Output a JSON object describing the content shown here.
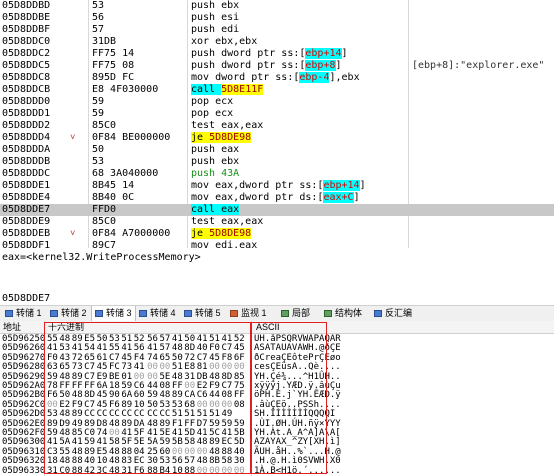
{
  "disasm": [
    {
      "addr": "05D8DDBD",
      "arrow": "",
      "bytes": "53",
      "instr": [
        [
          "push ebx",
          ""
        ]
      ],
      "cmt": ""
    },
    {
      "addr": "05D8DDBE",
      "arrow": "",
      "bytes": "56",
      "instr": [
        [
          "push esi",
          ""
        ]
      ],
      "cmt": ""
    },
    {
      "addr": "05D8DDBF",
      "arrow": "",
      "bytes": "57",
      "instr": [
        [
          "push edi",
          ""
        ]
      ],
      "cmt": ""
    },
    {
      "addr": "05D8DDC0",
      "arrow": "",
      "bytes": "31DB",
      "instr": [
        [
          "xor ebx,ebx",
          ""
        ]
      ],
      "cmt": ""
    },
    {
      "addr": "05D8DDC2",
      "arrow": "",
      "bytes": "FF75 14",
      "instr": [
        [
          "push dword ptr ss:[",
          ""
        ],
        [
          "ebp+14",
          "cyan"
        ],
        [
          "]",
          ""
        ]
      ],
      "cmt": ""
    },
    {
      "addr": "05D8DDC5",
      "arrow": "",
      "bytes": "FF75 08",
      "instr": [
        [
          "push dword ptr ss:[",
          ""
        ],
        [
          "ebp+8",
          "cyan"
        ],
        [
          "]",
          ""
        ]
      ],
      "cmt": "[ebp+8]:\"explorer.exe\""
    },
    {
      "addr": "05D8DDC8",
      "arrow": "",
      "bytes": "895D FC",
      "instr": [
        [
          "mov dword ptr ss:[",
          ""
        ],
        [
          "ebp-4",
          "cyan"
        ],
        [
          "],ebx",
          ""
        ]
      ],
      "cmt": ""
    },
    {
      "addr": "05D8DDCB",
      "arrow": "",
      "bytes": "E8 4F030000",
      "instr": [
        [
          "call ",
          "call"
        ],
        [
          "5D8E11F",
          "callt"
        ]
      ],
      "cmt": ""
    },
    {
      "addr": "05D8DDD0",
      "arrow": "",
      "bytes": "59",
      "instr": [
        [
          "pop ecx",
          ""
        ]
      ],
      "cmt": ""
    },
    {
      "addr": "05D8DDD1",
      "arrow": "",
      "bytes": "59",
      "instr": [
        [
          "pop ecx",
          ""
        ]
      ],
      "cmt": ""
    },
    {
      "addr": "05D8DDD2",
      "arrow": "",
      "bytes": "85C0",
      "instr": [
        [
          "test eax,eax",
          ""
        ]
      ],
      "cmt": ""
    },
    {
      "addr": "05D8DDD4",
      "arrow": "˅",
      "bytes": "0F84 BE000000",
      "instr": [
        [
          "je ",
          "je"
        ],
        [
          "5D8DE98",
          "jet"
        ]
      ],
      "cmt": ""
    },
    {
      "addr": "05D8DDDA",
      "arrow": "",
      "bytes": "50",
      "instr": [
        [
          "push eax",
          ""
        ]
      ],
      "cmt": ""
    },
    {
      "addr": "05D8DDDB",
      "arrow": "",
      "bytes": "53",
      "instr": [
        [
          "push ebx",
          ""
        ]
      ],
      "cmt": ""
    },
    {
      "addr": "05D8DDDC",
      "arrow": "",
      "bytes": "68 3A040000",
      "instr": [
        [
          "push 43A",
          "green"
        ]
      ],
      "cmt": ""
    },
    {
      "addr": "05D8DDE1",
      "arrow": "",
      "bytes": "8B45 14",
      "instr": [
        [
          "mov eax,dword ptr ss:[",
          ""
        ],
        [
          "ebp+14",
          "cyan"
        ],
        [
          "]",
          ""
        ]
      ],
      "cmt": ""
    },
    {
      "addr": "05D8DDE4",
      "arrow": "",
      "bytes": "8B40 0C",
      "instr": [
        [
          "mov eax,dword ptr ds:[",
          ""
        ],
        [
          "eax+C",
          "cyan"
        ],
        [
          "]",
          ""
        ]
      ],
      "cmt": ""
    },
    {
      "addr": "05D8DDE7",
      "arrow": "",
      "bytes": "FFD0",
      "instr": [
        [
          "call eax",
          "callsel"
        ]
      ],
      "cmt": "",
      "selected": true
    },
    {
      "addr": "05D8DDE9",
      "arrow": "",
      "bytes": "85C0",
      "instr": [
        [
          "test eax,eax",
          ""
        ]
      ],
      "cmt": ""
    },
    {
      "addr": "05D8DDEB",
      "arrow": "˅",
      "bytes": "0F84 A7000000",
      "instr": [
        [
          "je ",
          "je"
        ],
        [
          "5D8DE98",
          "jet"
        ]
      ],
      "cmt": ""
    },
    {
      "addr": "05D8DDF1",
      "arrow": "",
      "bytes": "89C7",
      "instr": [
        [
          "mov edi,eax",
          ""
        ]
      ],
      "cmt": ""
    }
  ],
  "info_line": "eax=<kernel32.WriteProcessMemory>",
  "addr_line": "05D8DDE7",
  "tabs": [
    {
      "label": "转储 1",
      "icon": "b"
    },
    {
      "label": "转储 2",
      "icon": "b"
    },
    {
      "label": "转储 3",
      "icon": "b",
      "active": true
    },
    {
      "label": "转储 4",
      "icon": "b"
    },
    {
      "label": "转储 5",
      "icon": "b"
    },
    {
      "label": "监视 1",
      "icon": "r"
    },
    {
      "label": "局部",
      "icon": "g"
    },
    {
      "label": "结构体",
      "icon": "g"
    },
    {
      "label": "反汇编",
      "icon": "b"
    }
  ],
  "dump_headers": {
    "addr": "地址",
    "hex": "十六进制",
    "ascii": "ASCII"
  },
  "dump_rows": [
    {
      "addr": "05D96250",
      "hex": "55 48 89 E5 50 53 51 52 56 57 41 50 41 51 41 52",
      "ascii": "UH.åPSQRVWAPAQAR"
    },
    {
      "addr": "05D96260",
      "hex": "41 53 41 54 41 55 41 56 41 57 48 8D 40 F0 C7 45",
      "ascii": "ASATAUAVAWH.@ðÇE"
    },
    {
      "addr": "05D96270",
      "hex": "F0 43 72 65 61 C7 45 F4 74 65 50 72 C7 45 F8 6F",
      "ascii": "ðCreaÇEôtePrÇEøo"
    },
    {
      "addr": "05D96280",
      "hex": "63 65 73 C7 45 FC 73 41 00 00 51 E8 81 00 00 00",
      "ascii": "cesÇEüsA..Qè...."
    },
    {
      "addr": "05D96290",
      "hex": "59 48 89 C7 E9 BE 01 00 00 5E 48 31 DB 48 8D 85",
      "ascii": "YH.Çé¾...^H1ÛH.."
    },
    {
      "addr": "05D962A0",
      "hex": "78 FF FF FF 6A 18 59 C6 44 08 FF 00 E2 F9 C7 75",
      "ascii": "xÿÿÿj.YÆD.ÿ.âùÇu"
    },
    {
      "addr": "05D962B0",
      "hex": "F6 50 48 8D 45 90 6A 60 59 48 89 CA C6 44 08 FF",
      "ascii": "öPH.E.j`YH.ÊÆD.ÿ"
    },
    {
      "addr": "05D962C0",
      "hex": "00 E2 F9 C7 45 F6 89 10 50 53 53 68 00 00 00 08",
      "ascii": ".âùÇEö..PSSh...."
    },
    {
      "addr": "05D962D0",
      "hex": "53 48 89 CC CC CC CC CC CC CC 51 51 51 51 49",
      "ascii": "SH.ÌÌÌÌÌÌÌQQQQI"
    },
    {
      "addr": "05D962E0",
      "hex": "89 D9 49 89 D8 48 89 DA 48 89 F1 FF D7 59 59 59",
      "ascii": ".ÙI.ØH.ÚH.ñÿ×YYY"
    },
    {
      "addr": "05D962F0",
      "hex": "59 48 85 C0 74 00 41 5F 41 5E 41 5D 41 5C 41 5B",
      "ascii": "YH.Àt.A_A^A]A\\A["
    },
    {
      "addr": "05D96300",
      "hex": "41 5A 41 59 41 58 5F 5E 5A 59 5B 58 48 89 EC 5D",
      "ascii": "AZAYAX_^ZY[XH.ì]"
    },
    {
      "addr": "05D96310",
      "hex": "C3 55 48 89 E5 48 88 04 25 60 00 00 00 48 88 40",
      "ascii": "ÃUH.åH..%`...H.@"
    },
    {
      "addr": "05D96320",
      "hex": "18 48 88 40 10 48 83 EC 30 53 56 57 48 8B 58 30",
      "ascii": ".H.@.H.ì0SVWH.X0"
    },
    {
      "addr": "05D96330",
      "hex": "31 C0 88 42 3C 48 31 F6 88 B4 10 88 00 00 00 00",
      "ascii": "1À.B<H1ö.´......"
    }
  ]
}
